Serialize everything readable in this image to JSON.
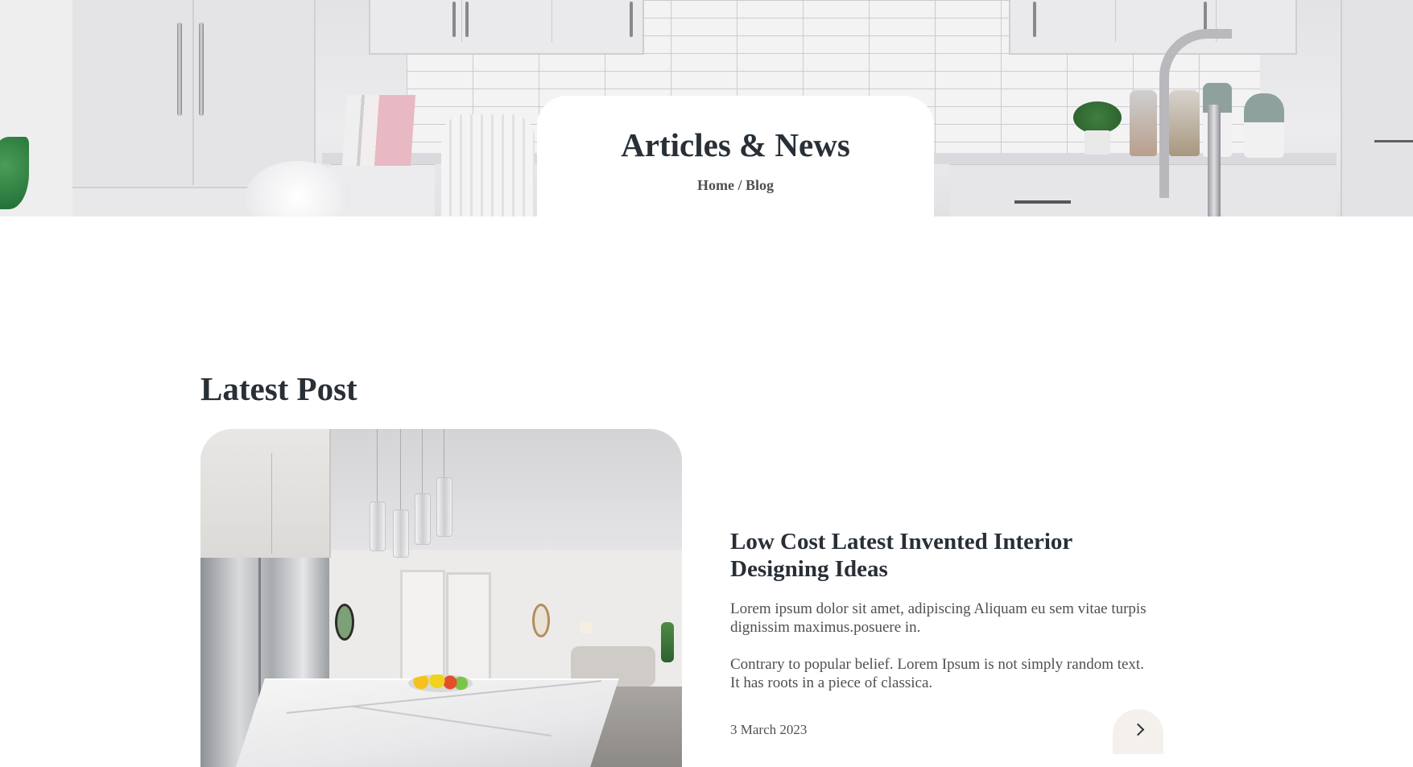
{
  "hero": {
    "title": "Articles & News",
    "breadcrumb": {
      "home": "Home",
      "separator": " / ",
      "current": "Blog"
    }
  },
  "latest_post": {
    "section_title": "Latest Post",
    "image_alt": "Bright white kitchen with marble island and pendant lights",
    "title": "Low Cost Latest Invented Interior Designing Ideas",
    "excerpt_1": "Lorem ipsum dolor sit amet, adipiscing Aliquam eu sem vitae turpis dignissim maximus.posuere in.",
    "excerpt_2": "Contrary to popular belief. Lorem Ipsum is not simply random text. It has roots in a piece of classica.",
    "date": "3 March 2023",
    "next_icon": "chevron-right-icon"
  },
  "colors": {
    "heading": "#292f36",
    "body_text": "#4d5053",
    "button_bg": "#f4f0ec",
    "background": "#ffffff"
  }
}
